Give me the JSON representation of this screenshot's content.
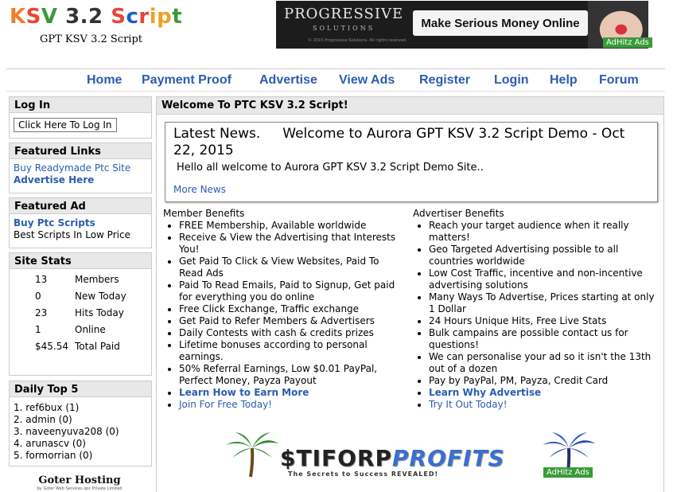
{
  "header": {
    "logo_parts": [
      "K",
      "S",
      "V",
      "3.2",
      "S",
      "c",
      "r",
      "ip",
      "t"
    ],
    "tagline": "GPT KSV 3.2 Script"
  },
  "top_banner": {
    "brand": "PROGRESSIVE",
    "sub": "SOLUTIONS",
    "tiny": "© 2015 Progressive Solutions. All rights reserved.",
    "cta": "Make Serious Money Online",
    "badge": "AdHitz Ads"
  },
  "nav": {
    "items": [
      "Home",
      "Payment Proof",
      "Advertise",
      "View Ads",
      "Register",
      "Login",
      "Help",
      "Forum"
    ]
  },
  "sidebar": {
    "login": {
      "title": "Log In",
      "button": "Click Here To Log In"
    },
    "featured_links": {
      "title": "Featured Links",
      "link1": "Buy Readymade Ptc Site",
      "link2": "Advertise Here"
    },
    "featured_ad": {
      "title": "Featured Ad",
      "link": "Buy Ptc Scripts",
      "desc": "Best Scripts In Low Price"
    },
    "site_stats": {
      "title": "Site Stats",
      "rows": [
        {
          "value": "13",
          "label": "Members"
        },
        {
          "value": "0",
          "label": "New Today"
        },
        {
          "value": "23",
          "label": "Hits Today"
        },
        {
          "value": "1",
          "label": "Online"
        },
        {
          "value": "$45.54",
          "label": "Total Paid"
        }
      ]
    },
    "daily_top": {
      "title": "Daily Top 5",
      "items": [
        "1. ref6bux (1)",
        "2. admin (0)",
        "3. naveenyuva208 (0)",
        "4. arunascv (0)",
        "5. formorrian (0)"
      ]
    },
    "hosting": {
      "name": "Goter Hosting",
      "sub": "by Goter Web Services opc Private Limited"
    }
  },
  "main": {
    "title": "Welcome To PTC KSV 3.2 Script!",
    "news": {
      "heading": "Latest News.",
      "headline": "Welcome to Aurora GPT KSV 3.2 Script Demo - Oct 22, 2015",
      "body": "Hello all welcome to Aurora GPT KSV 3.2 Script Demo Site..",
      "more": "More News"
    },
    "member": {
      "title": "Member Benefits",
      "items": [
        "FREE Membership, Available worldwide",
        "Receive & View the Advertising that Interests You!",
        "Get Paid To Click & View Websites, Paid To Read Ads",
        "Paid To Read Emails, Paid to Signup, Get paid for everything you do online",
        "Free Click Exchange, Traffic exchange",
        "Get Paid to Refer Members & Advertisers",
        "Daily Contests with cash & credits prizes",
        "Lifetime bonuses according to personal earnings.",
        "50% Referral Earnings, Low $0.01 PayPal, Perfect Money, Payza Payout"
      ],
      "link_bold": "Learn How to Earn More",
      "link": "Join For Free Today!"
    },
    "advertiser": {
      "title": "Advertiser Benefits",
      "items": [
        "Reach your target audience when it really matters!",
        "Geo Targeted Advertising possible to all countries worldwide",
        "Low Cost Traffic, incentive and non-incentive advertising solutions",
        "Many Ways To Advertise, Prices starting at only 1 Dollar",
        "24 Hours Unique Hits, Free Live Stats",
        "Bulk campains are possible contact us for questions!",
        "We can personalise your ad so it isn't the 13th out of a dozen",
        "Pay by PayPal, PM, Payza, Credit Card"
      ],
      "link_bold": "Learn Why Advertise",
      "link": "Try It Out Today!"
    },
    "bottom_banner": {
      "word1": "$TIFORP",
      "word2": "PROFITS",
      "tagline": "The Secrets to Success REVEALED!",
      "badge": "AdHitz Ads"
    }
  }
}
